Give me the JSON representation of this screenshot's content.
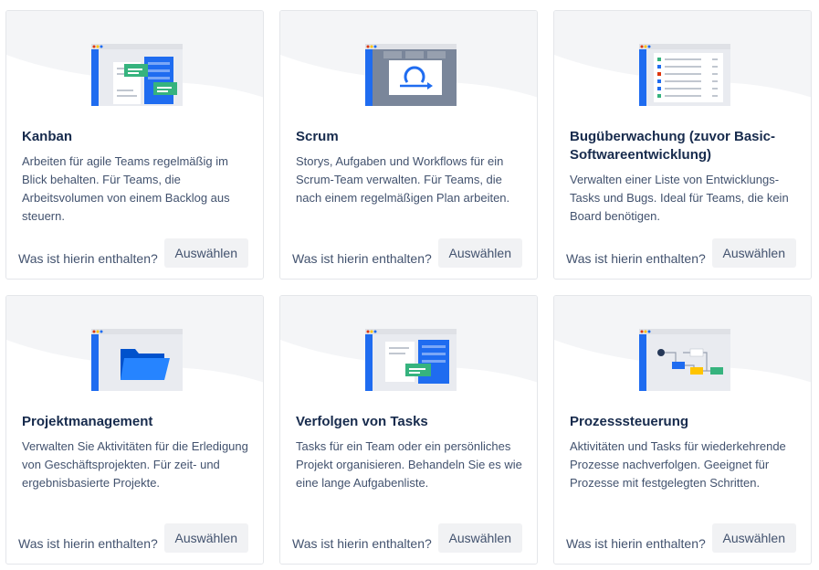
{
  "colors": {
    "brand_blue": "#0052cc",
    "bright_blue": "#1f6cf0",
    "green": "#36b37e",
    "yellow": "#ffc400",
    "red": "#de350b",
    "navy": "#253858"
  },
  "cards": [
    {
      "title": "Kanban",
      "description": "Arbeiten für agile Teams regelmäßig im Blick behalten. Für Teams, die Arbeitsvolumen von einem Backlog aus steuern.",
      "more_link": "Was ist hierin enthalten?",
      "select_button": "Auswählen",
      "illustration": "kanban-board-icon"
    },
    {
      "title": "Scrum",
      "description": "Storys, Aufgaben und Workflows für ein Scrum-Team verwalten. Für Teams, die nach einem regelmäßigen Plan arbeiten.",
      "more_link": "Was ist hierin enthalten?",
      "select_button": "Auswählen",
      "illustration": "scrum-sprint-icon"
    },
    {
      "title": "Bugüberwachung (zuvor Basic-Softwareentwicklung)",
      "description": "Verwalten einer Liste von Entwicklungs-Tasks und Bugs. Ideal für Teams, die kein Board benötigen.",
      "more_link": "Was ist hierin enthalten?",
      "select_button": "Auswählen",
      "illustration": "bug-list-icon"
    },
    {
      "title": "Projektmanagement",
      "description": "Verwalten Sie Aktivitäten für die Erledigung von Geschäftsprojekten. Für zeit- und ergebnisbasierte Projekte.",
      "more_link": "Was ist hierin enthalten?",
      "select_button": "Auswählen",
      "illustration": "folder-icon"
    },
    {
      "title": "Verfolgen von Tasks",
      "description": "Tasks für ein Team oder ein persönliches Projekt organisieren. Behandeln Sie es wie eine lange Aufgabenliste.",
      "more_link": "Was ist hierin enthalten?",
      "select_button": "Auswählen",
      "illustration": "task-tracking-icon"
    },
    {
      "title": "Prozesssteuerung",
      "description": "Aktivitäten und Tasks für wiederkehrende Prozesse nachverfolgen. Geeignet für Prozesse mit festgelegten Schritten.",
      "more_link": "Was ist hierin enthalten?",
      "select_button": "Auswählen",
      "illustration": "workflow-icon"
    }
  ]
}
